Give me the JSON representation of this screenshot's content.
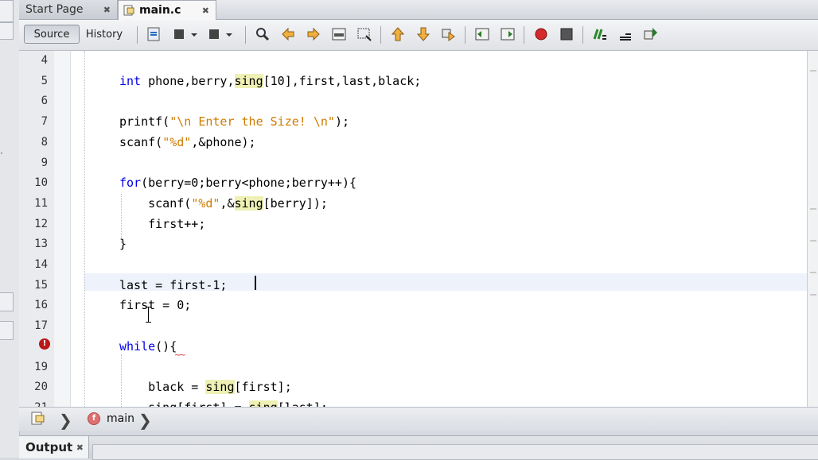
{
  "tabs": [
    {
      "label": "Start Page",
      "close": "✖"
    },
    {
      "label": "main.c",
      "close": "✖"
    }
  ],
  "toolbar": {
    "source_label": "Source",
    "history_label": "History"
  },
  "editor": {
    "lines": [
      {
        "num": "4",
        "segments": []
      },
      {
        "num": "5",
        "segments": [
          {
            "t": "int",
            "c": "kw"
          },
          {
            "t": " phone,berry,"
          },
          {
            "t": "sing",
            "c": "hl"
          },
          {
            "t": "[10],first,last,black;"
          }
        ]
      },
      {
        "num": "6",
        "segments": []
      },
      {
        "num": "7",
        "segments": [
          {
            "t": "printf("
          },
          {
            "t": "\"\\n Enter the Size! \\n\"",
            "c": "str"
          },
          {
            "t": ");"
          }
        ]
      },
      {
        "num": "8",
        "segments": [
          {
            "t": "scanf("
          },
          {
            "t": "\"%d\"",
            "c": "str"
          },
          {
            "t": ",&phone);"
          }
        ]
      },
      {
        "num": "9",
        "segments": []
      },
      {
        "num": "10",
        "segments": [
          {
            "t": "for",
            "c": "kw"
          },
          {
            "t": "(berry=0;berry<phone;berry++){"
          }
        ]
      },
      {
        "num": "11",
        "segments": [
          {
            "t": "    scanf("
          },
          {
            "t": "\"%d\"",
            "c": "str"
          },
          {
            "t": ",&"
          },
          {
            "t": "sing",
            "c": "hl"
          },
          {
            "t": "[berry]);"
          }
        ]
      },
      {
        "num": "12",
        "segments": [
          {
            "t": "    first++;"
          }
        ]
      },
      {
        "num": "13",
        "segments": [
          {
            "t": "}"
          }
        ]
      },
      {
        "num": "14",
        "segments": []
      },
      {
        "num": "15",
        "segments": [
          {
            "t": "last = first-1;"
          }
        ]
      },
      {
        "num": "16",
        "segments": [
          {
            "t": "first = 0;"
          }
        ]
      },
      {
        "num": "17",
        "segments": []
      },
      {
        "num": "",
        "segments": [
          {
            "t": "while",
            "c": "kw"
          },
          {
            "t": "(){"
          }
        ]
      },
      {
        "num": "19",
        "segments": []
      },
      {
        "num": "20",
        "segments": [
          {
            "t": "    black = "
          },
          {
            "t": "sing",
            "c": "hl"
          },
          {
            "t": "[first];"
          }
        ]
      },
      {
        "num": "21",
        "segments": [
          {
            "t": "    sing[first] = "
          },
          {
            "t": "sing",
            "c": "hl"
          },
          {
            "t": "[last];"
          }
        ]
      }
    ],
    "error_marker": "!"
  },
  "breadcrumb": {
    "func_icon": "f",
    "function": "main"
  },
  "output": {
    "label": "Output",
    "close": "✖"
  }
}
